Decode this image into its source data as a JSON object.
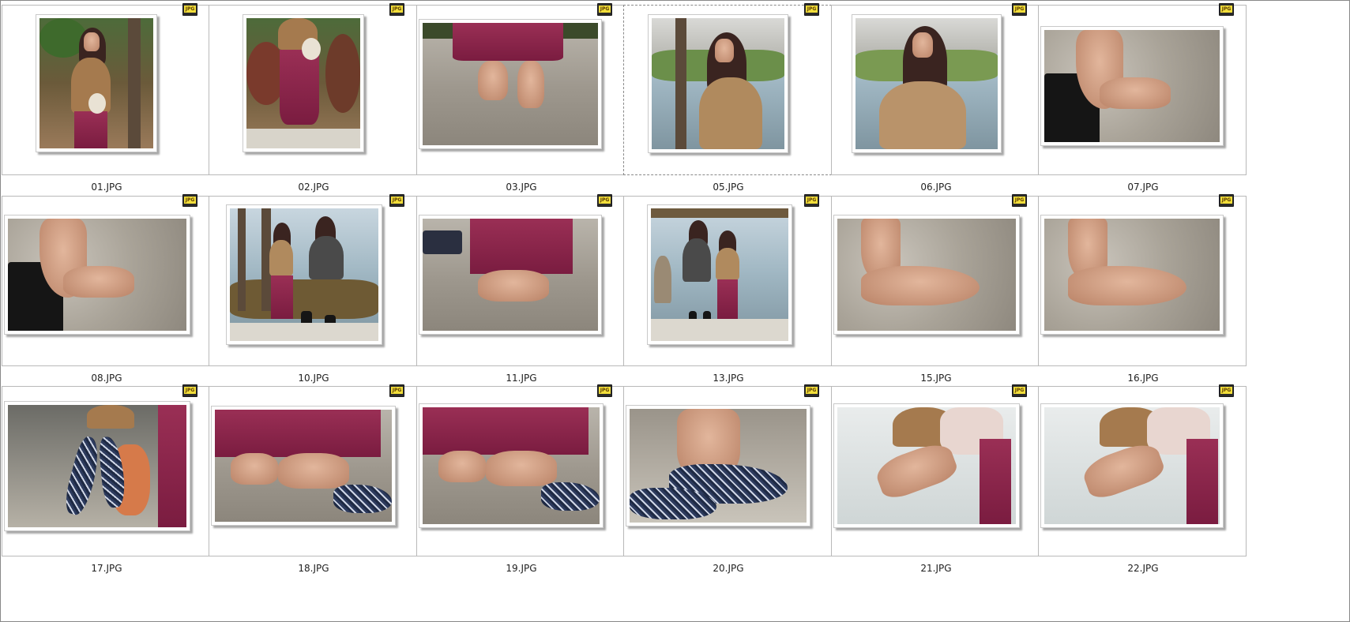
{
  "files": [
    {
      "name": "01.JPG",
      "scene": "portrait-park",
      "badge": "JPG"
    },
    {
      "name": "02.JPG",
      "scene": "standing-skirt",
      "badge": "JPG"
    },
    {
      "name": "03.JPG",
      "scene": "feet-sand-skirt",
      "badge": "JPG"
    },
    {
      "name": "05.JPG",
      "scene": "portrait-lake",
      "badge": "JPG"
    },
    {
      "name": "06.JPG",
      "scene": "portrait-lake-2",
      "badge": "JPG"
    },
    {
      "name": "07.JPG",
      "scene": "feet-boot",
      "badge": "JPG"
    },
    {
      "name": "08.JPG",
      "scene": "feet-boot-2",
      "badge": "JPG"
    },
    {
      "name": "10.JPG",
      "scene": "two-women-lake",
      "badge": "JPG"
    },
    {
      "name": "11.JPG",
      "scene": "foot-skirt-sand",
      "badge": "JPG"
    },
    {
      "name": "13.JPG",
      "scene": "group-lake",
      "badge": "JPG"
    },
    {
      "name": "15.JPG",
      "scene": "foot-sand",
      "badge": "JPG"
    },
    {
      "name": "16.JPG",
      "scene": "foot-sand-2",
      "badge": "JPG"
    },
    {
      "name": "17.JPG",
      "scene": "holding-shoes",
      "badge": "JPG"
    },
    {
      "name": "18.JPG",
      "scene": "feet-shoes",
      "badge": "JPG"
    },
    {
      "name": "19.JPG",
      "scene": "feet-shoes-2",
      "badge": "JPG"
    },
    {
      "name": "20.JPG",
      "scene": "foot-in-shoe",
      "badge": "JPG"
    },
    {
      "name": "21.JPG",
      "scene": "foot-lifted",
      "badge": "JPG"
    },
    {
      "name": "22.JPG",
      "scene": "foot-lifted-2",
      "badge": "JPG"
    }
  ],
  "selected_file": "05.JPG",
  "colors": {
    "skirt": "#8b2450",
    "sand": "#a39d92",
    "tile_border": "#b9b9b9",
    "badge_yellow": "#f2de3a"
  }
}
